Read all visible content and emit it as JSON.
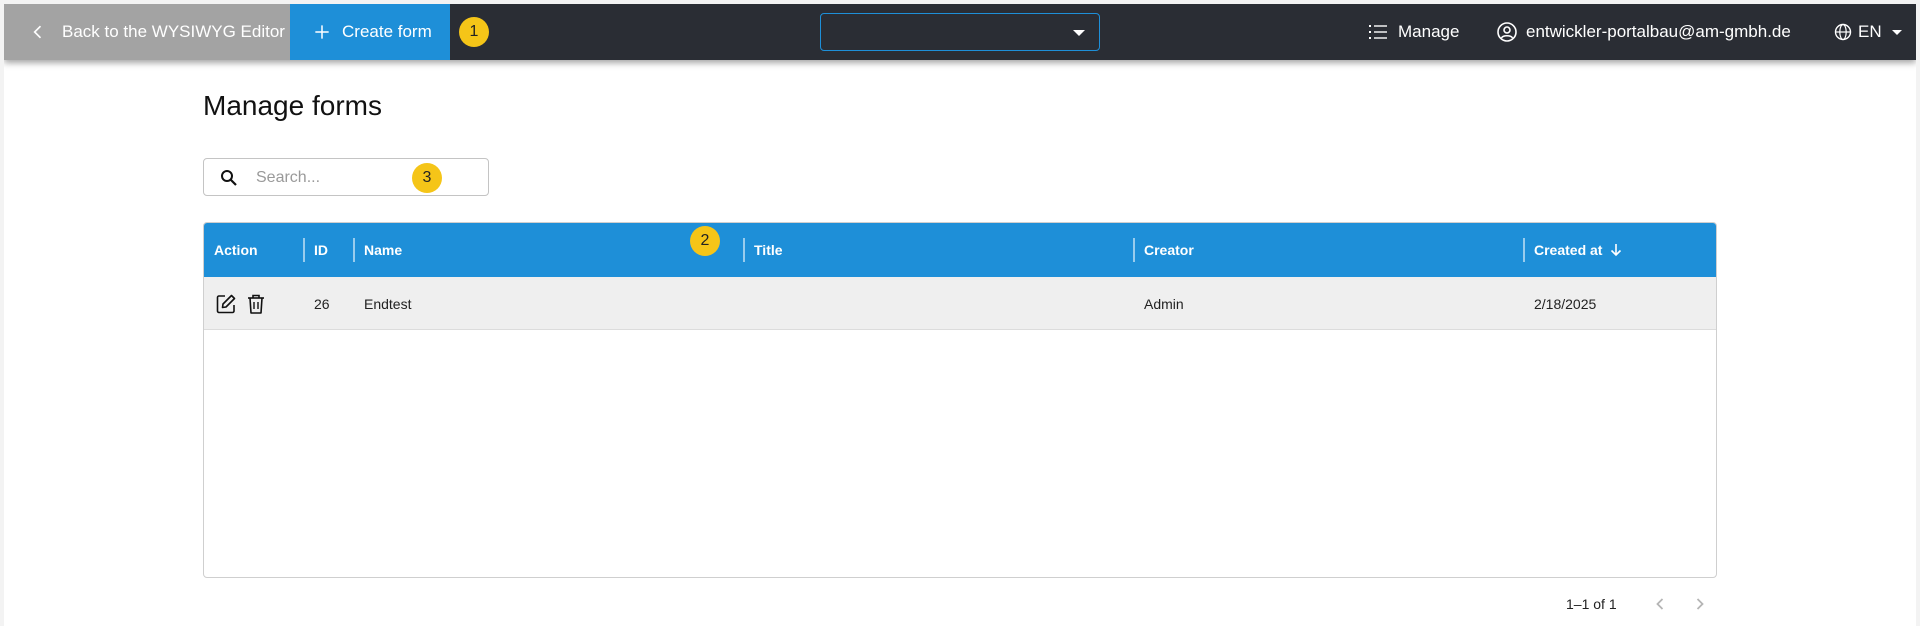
{
  "topbar": {
    "back_label": "Back to the WYSIWYG Editor",
    "create_label": "Create form",
    "form_select_value": "",
    "manage_label": "Manage",
    "user_email": "entwickler-portalbau@am-gmbh.de",
    "language": "EN"
  },
  "annotations": [
    "1",
    "2",
    "3"
  ],
  "page": {
    "title": "Manage forms",
    "search_placeholder": "Search..."
  },
  "table": {
    "columns": [
      "Action",
      "ID",
      "Name",
      "Title",
      "Creator",
      "Created at"
    ],
    "rows": [
      {
        "id": "26",
        "name": "Endtest",
        "title": "",
        "creator": "Admin",
        "created_at": "2/18/2025"
      }
    ]
  },
  "pagination": {
    "range": "1–1 of 1"
  },
  "colors": {
    "topbar": "#2a2d34",
    "accent": "#1e8fd8",
    "back_button": "#a3a3a3",
    "badge": "#f5c518"
  },
  "icons": [
    "chevron-left-icon",
    "plus-icon",
    "chevron-down-icon",
    "list-icon",
    "account-circle-icon",
    "globe-icon",
    "search-icon",
    "arrow-down-icon",
    "edit-icon",
    "trash-icon",
    "chevron-right-icon"
  ]
}
